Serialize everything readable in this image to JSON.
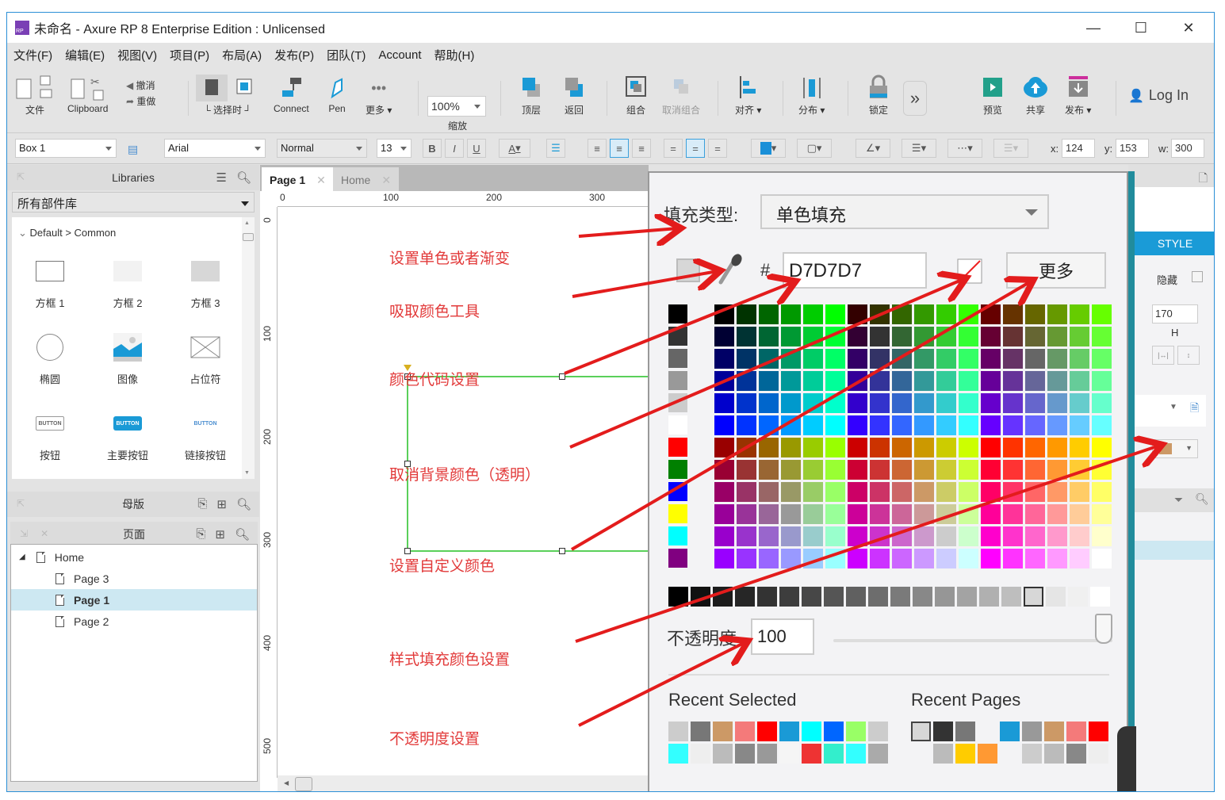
{
  "window": {
    "logo_text": "RP",
    "title": "未命名 - Axure RP 8 Enterprise Edition : Unlicensed",
    "controls": {
      "minimize": "—",
      "maximize": "☐",
      "close": "✕"
    }
  },
  "menu": [
    "文件(F)",
    "编辑(E)",
    "视图(V)",
    "项目(P)",
    "布局(A)",
    "发布(P)",
    "团队(T)",
    "Account",
    "帮助(H)"
  ],
  "toolbar": {
    "file": "文件",
    "clipboard": "Clipboard",
    "undo": "撤消",
    "redo": "重做",
    "select_mode": "└ 选择时 ┘",
    "connect": "Connect",
    "pen": "Pen",
    "more": "更多 ▾",
    "zoom_value": "100%",
    "zoom_label": "缩放",
    "top": "顶层",
    "back": "返回",
    "group": "组合",
    "ungroup": "取消组合",
    "align": "对齐 ▾",
    "distribute": "分布 ▾",
    "lock": "锁定",
    "expand": "»",
    "preview": "预览",
    "share": "共享",
    "publish": "发布 ▾",
    "login": "Log In"
  },
  "formatbar": {
    "widget_name": "Box 1",
    "font": "Arial",
    "weight": "Normal",
    "size": "13",
    "bold": "B",
    "italic": "I",
    "underline": "U",
    "font_color_glyph": "A",
    "x_label": "x:",
    "x_value": "124",
    "y_label": "y:",
    "y_value": "153",
    "w_label": "w:",
    "w_value": "300",
    "fill_color": "#1a8fd8"
  },
  "libraries": {
    "title": "Libraries",
    "selected_library": "所有部件库",
    "category": "Default > Common",
    "widgets": [
      {
        "label": "方框 1",
        "icon": "box1-icon"
      },
      {
        "label": "方框 2",
        "icon": "box2-icon"
      },
      {
        "label": "方框 3",
        "icon": "box3-icon"
      },
      {
        "label": "椭圆",
        "icon": "ellipse-icon"
      },
      {
        "label": "图像",
        "icon": "image-icon"
      },
      {
        "label": "占位符",
        "icon": "placeholder-icon"
      },
      {
        "label": "按钮",
        "icon": "button-icon",
        "glyph": "BUTTON"
      },
      {
        "label": "主要按钮",
        "icon": "primary-button-icon",
        "glyph": "BUTTON"
      },
      {
        "label": "链接按钮",
        "icon": "link-button-icon",
        "glyph": "BUTTON"
      }
    ]
  },
  "masters": {
    "title": "母版"
  },
  "pages": {
    "title": "页面",
    "items": [
      {
        "label": "Home",
        "level": 0,
        "selected": false
      },
      {
        "label": "Page 3",
        "level": 1,
        "selected": false
      },
      {
        "label": "Page 1",
        "level": 1,
        "selected": true
      },
      {
        "label": "Page 2",
        "level": 1,
        "selected": false
      }
    ]
  },
  "canvas": {
    "tabs": [
      {
        "label": "Page 1",
        "active": true
      },
      {
        "label": "Home",
        "active": false
      }
    ],
    "ruler_h": [
      "0",
      "100",
      "200",
      "300"
    ],
    "ruler_v": [
      "0",
      "100",
      "200",
      "300",
      "400",
      "500"
    ],
    "annotations": [
      "设置单色或者渐变",
      "吸取颜色工具",
      "颜色代码设置",
      "取消背景颜色（透明）",
      "设置自定义颜色",
      "样式填充颜色设置",
      "不透明度设置"
    ]
  },
  "color_picker": {
    "fill_type_label": "填充类型:",
    "fill_type_value": "单色填充",
    "hash": "#",
    "hex_value": "D7D7D7",
    "more_button": "更多",
    "opacity_label": "不透明度",
    "opacity_value": "100",
    "opacity_percent": 100,
    "recent_selected_label": "Recent Selected",
    "recent_pages_label": "Recent Pages",
    "current_color": "#d7d7d7",
    "basic_colors": [
      "#000000",
      "#333333",
      "#666666",
      "#999999",
      "#cccccc",
      "#ffffff",
      "#ff0000",
      "#008000",
      "#0000ff",
      "#ffff00",
      "#00ffff",
      "#800080"
    ],
    "gray_scale": [
      "#000000",
      "#111111",
      "#1c1c1c",
      "#262626",
      "#333333",
      "#3d3d3d",
      "#474747",
      "#555555",
      "#606060",
      "#6d6d6d",
      "#7a7a7a",
      "#888888",
      "#969696",
      "#a3a3a3",
      "#b0b0b0",
      "#bebebe",
      "#d7d7d7",
      "#e5e5e5",
      "#f0f0f0",
      "#ffffff"
    ],
    "recent_selected": [
      "#cccccc",
      "#777777",
      "#cc9966",
      "#f47a7a",
      "#ff0000",
      "#1a9ad6",
      "#00ffff",
      "#0066ff",
      "#99ff66",
      "#cccccc",
      "#33ffff",
      "#eeeeee",
      "#bbbbbb",
      "#888888",
      "#999999",
      "#f5f5f5",
      "#ee3333",
      "#33eecc",
      "#33ffff",
      "#aaaaaa"
    ],
    "recent_pages": [
      "#d7d7d7",
      "#333333",
      "#777777",
      "#f3f3f5",
      "#1a9ad6",
      "#999999",
      "#cc9966",
      "#f47a7a",
      "#ff0000",
      "#f3f3f5",
      "#bbbbbb",
      "#ffcc00",
      "#ff9933",
      "#f3f3f5",
      "#cccccc",
      "#bbbbbb",
      "#888888",
      "#eeeeee"
    ]
  },
  "inspector": {
    "style_tab": "STYLE",
    "hidden_label": "隐藏",
    "h_value": "170",
    "h_label": "H",
    "fill_swatch": "#cc9966"
  }
}
